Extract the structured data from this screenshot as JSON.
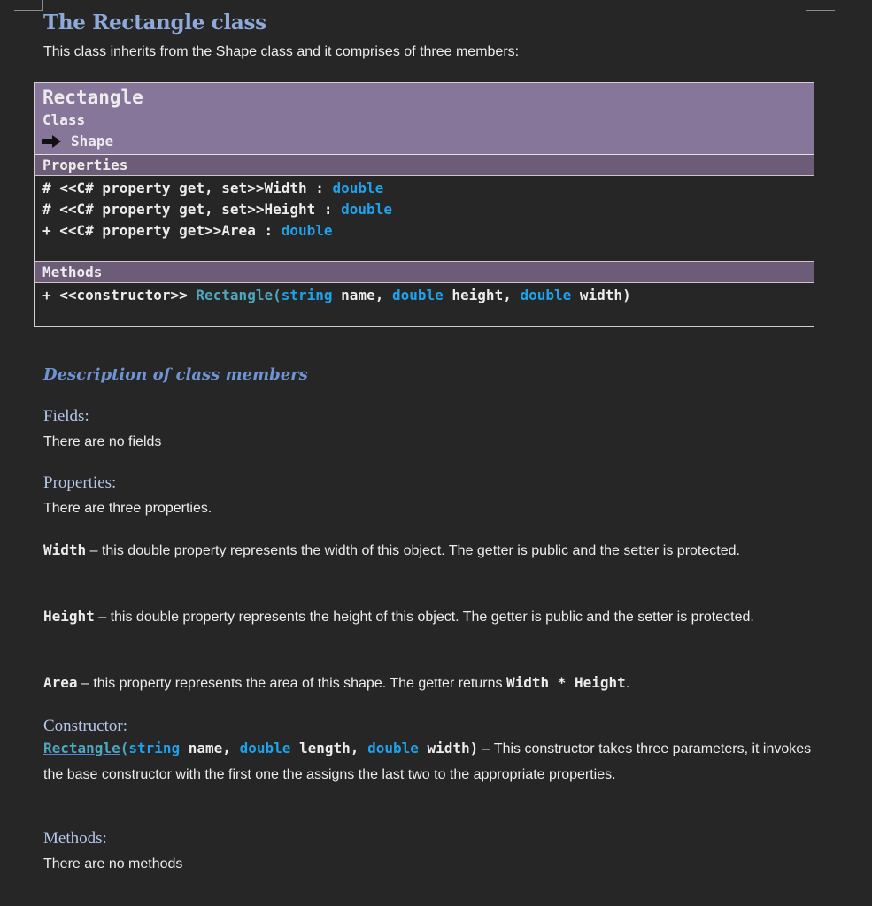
{
  "heading": "The Rectangle class",
  "intro": "This class inherits from the Shape class and it comprises of three members:",
  "uml": {
    "class_name": "Rectangle",
    "stereotype": "Class",
    "parent": "Shape",
    "properties_label": "Properties",
    "properties": [
      {
        "prefix": "# <<C# property get, set>>Width : ",
        "type": "double"
      },
      {
        "prefix": "# <<C# property get, set>>Height : ",
        "type": "double"
      },
      {
        "prefix": "+ <<C# property get>>Area : ",
        "type": "double"
      }
    ],
    "methods_label": "Methods",
    "constructor": {
      "prefix": "+ <<constructor>> ",
      "name": "Rectangle",
      "open": "(",
      "t1": "string",
      "p1": " name, ",
      "t2": "double",
      "p2": " height, ",
      "t3": "double",
      "p3": " width)"
    }
  },
  "description": {
    "title": "Description of class members",
    "fields_heading": "Fields:",
    "fields_text": "There are no fields",
    "properties_heading": "Properties:",
    "properties_text": "There are three properties.",
    "width_name": "Width",
    "width_text": " – this double property represents the width of this object. The getter is public and the setter is protected.",
    "height_name": "Height",
    "height_text": " – this double property represents the height of this object. The getter is public and the setter is protected.",
    "area_name": "Area",
    "area_text": " – this property represents the area of this shape. The getter returns ",
    "area_expr": "Width * Height",
    "area_end": ".",
    "constructor_heading": "Constructor:",
    "ctor_name": "Rectangle",
    "ctor_open": "(",
    "ctor_t1": "string",
    "ctor_p1": " name, ",
    "ctor_t2": "double",
    "ctor_p2": " length, ",
    "ctor_t3": "double",
    "ctor_p3": " width)",
    "ctor_text": " – This constructor takes three parameters, it invokes the base constructor with the first one the assigns the last two to the appropriate properties.",
    "methods_heading": "Methods:",
    "methods_text": "There are no methods"
  }
}
